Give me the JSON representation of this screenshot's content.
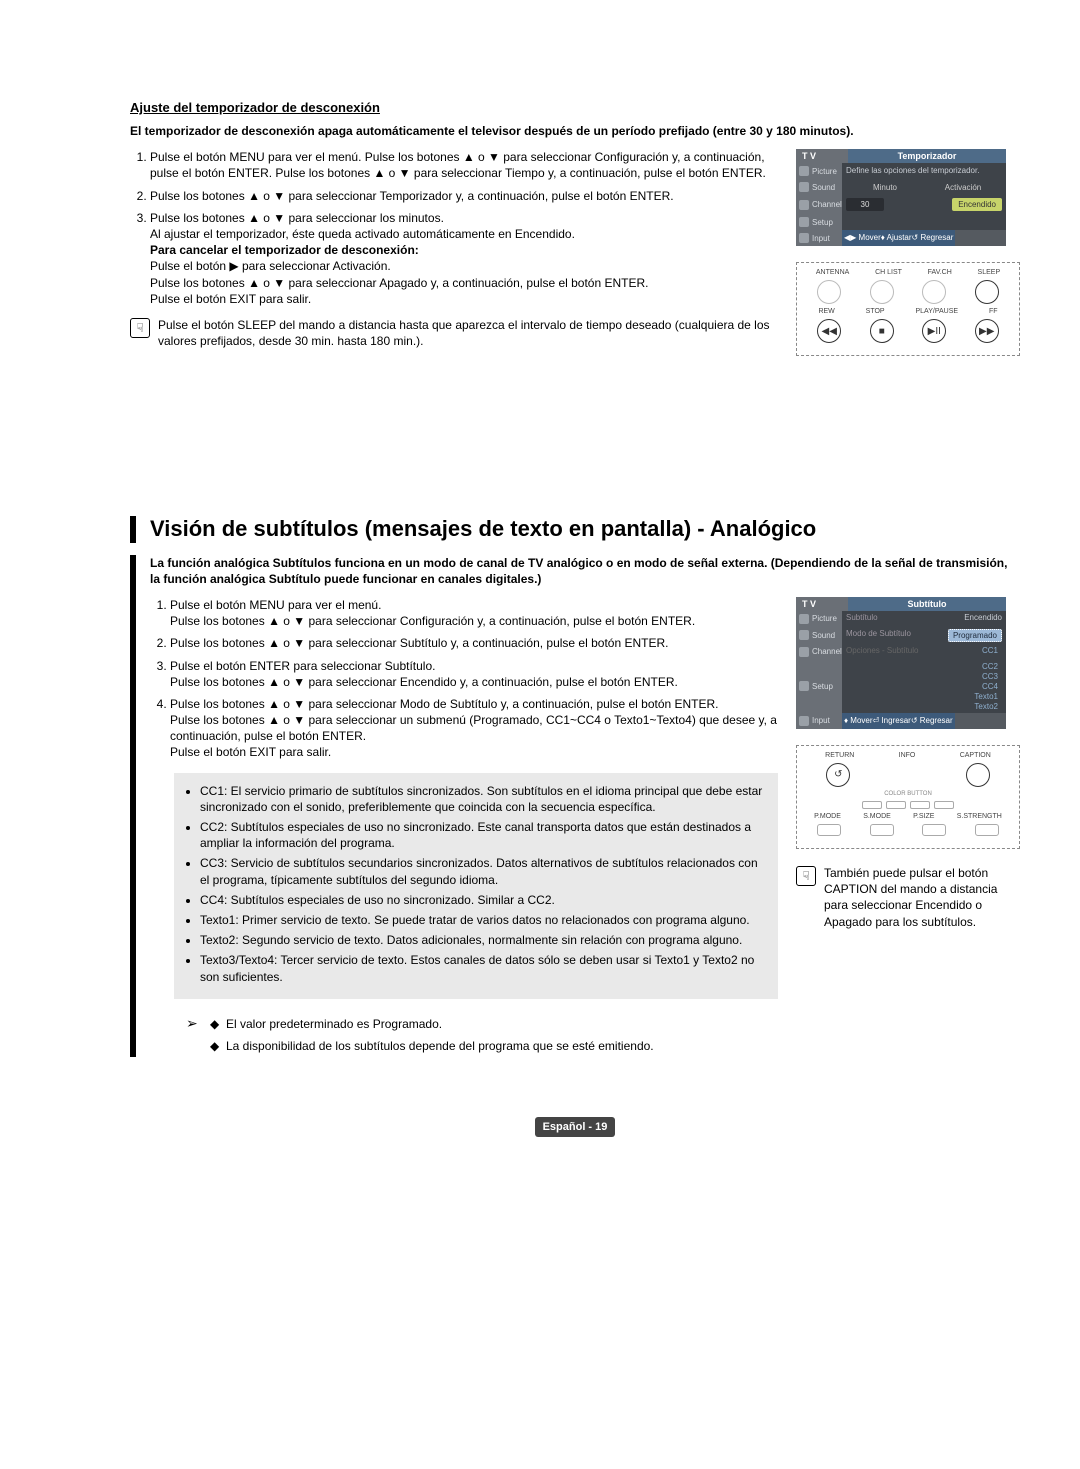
{
  "sec1": {
    "title": "Ajuste del temporizador de desconexión",
    "lead": "El temporizador de desconexión apaga automáticamente el televisor después de un período prefijado (entre 30 y 180 minutos).",
    "step1": "Pulse el botón MENU para ver el menú. Pulse los botones ▲ o ▼ para seleccionar Configuración y, a continuación, pulse el botón ENTER. Pulse los botones ▲ o ▼ para seleccionar Tiempo y, a continuación, pulse el botón ENTER.",
    "step2": "Pulse los botones ▲ o ▼ para seleccionar Temporizador y, a continuación, pulse el botón ENTER.",
    "step3a": "Pulse los botones ▲ o ▼ para seleccionar los minutos.",
    "step3b": "Al ajustar el temporizador, éste queda activado automáticamente en Encendido.",
    "cancel_title": "Para cancelar el temporizador de desconexión:",
    "cancel1": "Pulse el botón ▶ para seleccionar Activación.",
    "cancel2": "Pulse los botones ▲ o ▼ para seleccionar Apagado y, a continuación, pulse el botón ENTER.",
    "exit": "Pulse el botón EXIT para salir.",
    "hint": "Pulse el botón SLEEP del mando a distancia hasta que aparezca el intervalo de tiempo deseado (cualquiera de los valores prefijados, desde 30 min. hasta 180 min.)."
  },
  "menu1": {
    "tablabel": "T V",
    "title": "Temporizador",
    "desc": "Define las opciones del temporizador.",
    "side_picture": "Picture",
    "side_sound": "Sound",
    "side_channel": "Channel",
    "side_setup": "Setup",
    "side_input": "Input",
    "col_minute": "Minuto",
    "col_activation": "Activación",
    "val_minute": "30",
    "val_activation": "Encendido",
    "foot_move": "◀▶ Mover",
    "foot_adjust": "♦ Ajustar",
    "foot_return": "↺ Regresar"
  },
  "remote1": {
    "l1": "ANTENNA",
    "l2": "CH LIST",
    "l3": "FAV.CH",
    "l4": "SLEEP",
    "l5": "REW",
    "l6": "STOP",
    "l7": "PLAY/PAUSE",
    "l8": "FF",
    "b1": "◀◀",
    "b2": "■",
    "b3": "▶II",
    "b4": "▶▶"
  },
  "sec2": {
    "heading": "Visión de subtítulos (mensajes de texto en pantalla) - Analógico",
    "lead": "La función analógica Subtítulos funciona en un modo de canal de TV analógico o en modo de señal externa. (Dependiendo de la señal de transmisión, la función analógica Subtítulo puede funcionar en canales digitales.)",
    "s1a": "Pulse el botón MENU para ver el menú.",
    "s1b": "Pulse los botones ▲ o ▼ para seleccionar Configuración y, a continuación, pulse el botón ENTER.",
    "s2": "Pulse los botones ▲ o ▼ para seleccionar Subtítulo y, a continuación, pulse el botón ENTER.",
    "s3a": "Pulse el botón ENTER para seleccionar Subtítulo.",
    "s3b": "Pulse los botones ▲ o ▼ para seleccionar Encendido y, a continuación, pulse el botón ENTER.",
    "s4a": "Pulse los botones ▲ o ▼ para seleccionar Modo de Subtítulo y, a continuación, pulse el botón ENTER.",
    "s4b": "Pulse los botones ▲ o ▼ para seleccionar un submenú (Programado, CC1~CC4 o Texto1~Texto4) que desee y, a continuación, pulse el botón ENTER.",
    "exit": "Pulse el botón EXIT para salir.",
    "cc1": "CC1: El servicio primario de subtítulos sincronizados. Son subtítulos en el idioma principal que debe estar sincronizado con el sonido, preferiblemente que coincida con la secuencia específica.",
    "cc2": "CC2: Subtítulos especiales de uso no sincronizado. Este canal transporta datos que están destinados a ampliar la información del programa.",
    "cc3": "CC3: Servicio de subtítulos secundarios sincronizados. Datos alternativos de subtítulos relacionados con el programa, típicamente subtítulos del segundo idioma.",
    "cc4": "CC4: Subtítulos especiales de uso no sincronizado. Similar a CC2.",
    "t1": "Texto1: Primer servicio de texto. Se puede tratar de varios datos no relacionados con programa alguno.",
    "t2": "Texto2: Segundo servicio de texto. Datos adicionales, normalmente sin relación con programa alguno.",
    "t34": "Texto3/Texto4: Tercer servicio de texto. Estos canales de datos sólo se deben usar si Texto1 y Texto2 no son suficientes.",
    "note1": "El valor predeterminado es Programado.",
    "note2": "La disponibilidad de los subtítulos depende del programa que se esté emitiendo.",
    "side_tip": "También puede pulsar el botón CAPTION del mando a distancia para seleccionar Encendido o Apagado para los subtítulos."
  },
  "menu2": {
    "tablabel": "T V",
    "title": "Subtítulo",
    "row_subtitle": "Subtítulo",
    "val_subtitle": "Encendido",
    "row_mode": "Modo de Subtítulo",
    "row_opts": "Opciones - Subtítulo",
    "selected": "Programado",
    "o_cc1": "CC1",
    "o_cc2": "CC2",
    "o_cc3": "CC3",
    "o_cc4": "CC4",
    "o_t1": "Texto1",
    "o_t2": "Texto2",
    "foot_move": "♦ Mover",
    "foot_enter": "⏎ Ingresar",
    "foot_return": "↺ Regresar"
  },
  "remote2": {
    "l1": "RETURN",
    "l2": "INFO",
    "l3": "CAPTION",
    "color_label": "COLOR BUTTON",
    "b1": "P.MODE",
    "b2": "S.MODE",
    "b3": "P.SIZE",
    "b4": "S.STRENGTH"
  },
  "footer": {
    "lang": "Español - ",
    "page": "19"
  }
}
